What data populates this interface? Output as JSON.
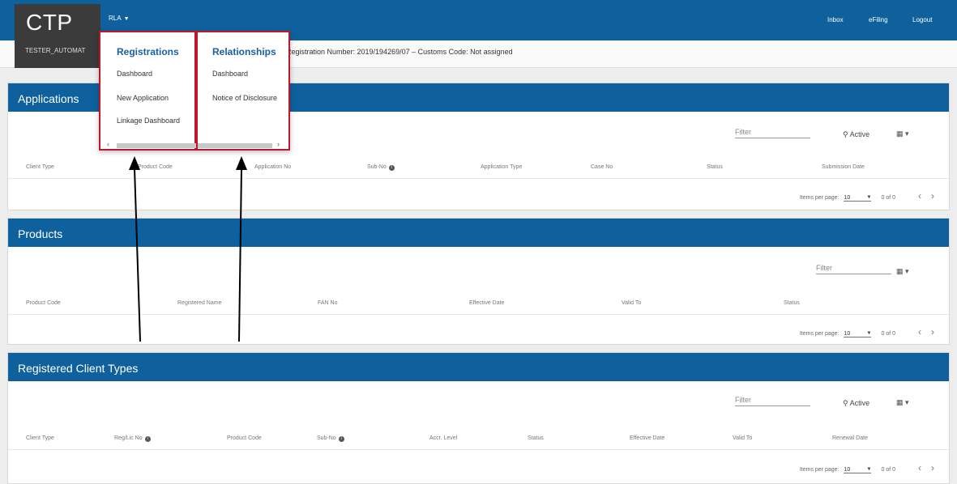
{
  "app": {
    "logo": "CTP",
    "user": "TESTER_AUTOMAT",
    "menu_label": "RLA"
  },
  "topnav": {
    "inbox": "Inbox",
    "efiling": "eFiling",
    "logout": "Logout"
  },
  "infobar": {
    "registration": "Registration Number: 2019/194269/07 – Customs Code: Not assigned"
  },
  "dropdown": {
    "registrations": {
      "title": "Registrations",
      "items": [
        "Dashboard",
        "New Application",
        "Linkage Dashboard"
      ]
    },
    "relationships": {
      "title": "Relationships",
      "items": [
        "Dashboard",
        "Notice of Disclosure"
      ]
    }
  },
  "applications": {
    "title": "Applications",
    "filter_placeholder": "Filter",
    "active_label": "Active",
    "columns": [
      "Client Type",
      "Product Code",
      "Application No",
      "Sub-No",
      "Application Type",
      "Case No",
      "Status",
      "Submission Date"
    ],
    "pager": {
      "label": "Items per page:",
      "value": "10",
      "range": "0 of 0"
    }
  },
  "products": {
    "title": "Products",
    "filter_placeholder": "Filter",
    "columns": [
      "Product Code",
      "Registered Name",
      "FAN No",
      "Effective Date",
      "Valid To",
      "Status"
    ],
    "pager": {
      "label": "Items per page:",
      "value": "10",
      "range": "0 of 0"
    }
  },
  "client_types": {
    "title": "Registered Client Types",
    "filter_placeholder": "Filter",
    "active_label": "Active",
    "columns": [
      "Client Type",
      "Reg/Lic No",
      "Product Code",
      "Sub-No",
      "Accr. Level",
      "Status",
      "Effective Date",
      "Valid To",
      "Renewal Date"
    ],
    "pager": {
      "label": "Items per page:",
      "value": "10",
      "range": "0 of 0"
    }
  },
  "colors": {
    "primary": "#0e619d",
    "logo_bg": "#3b3b3b",
    "highlight": "#c0162a",
    "menu_title": "#1a5fa3"
  }
}
